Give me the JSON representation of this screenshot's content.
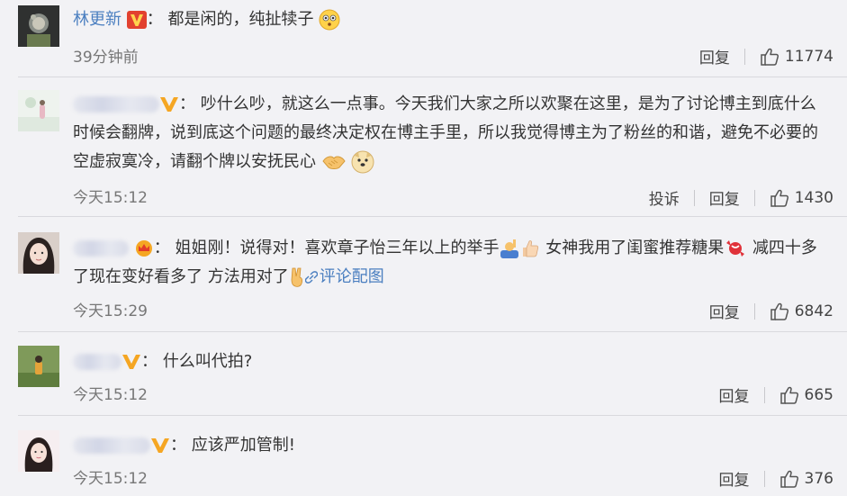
{
  "comments": [
    {
      "username": "林更新",
      "text": "都是闲的，纯扯犊子",
      "time": "39分钟前",
      "reply_label": "回复",
      "likes": "11774"
    },
    {
      "text": "吵什么吵，就这么一点事。今天我们大家之所以欢聚在这里，是为了讨论博主到底什么时候会翻牌，说到底这个问题的最终决定权在博主手里，所以我觉得博主为了粉丝的和谐，避免不必要的空虚寂寞冷，请翻个牌以安抚民心",
      "time": "今天15:12",
      "report_label": "投诉",
      "reply_label": "回复",
      "likes": "1430"
    },
    {
      "text_a": "姐姐刚！说得对！喜欢章子怡三年以上的举手",
      "text_b": "女神我用了闺蜜推荐糖果",
      "text_c": "减四十多了现在变好看多了 方法用对了",
      "link": "评论配图",
      "time": "今天15:29",
      "reply_label": "回复",
      "likes": "6842"
    },
    {
      "text": "什么叫代拍?",
      "time": "今天15:12",
      "reply_label": "回复",
      "likes": "665"
    },
    {
      "text": "应该严加管制!",
      "time": "今天15:12",
      "reply_label": "回复",
      "likes": "376"
    }
  ],
  "colors": {
    "link": "#4b7fc0",
    "background": "#f2f2f5",
    "badge_orange": "#f5a623"
  },
  "icons": [
    "verified-v-icon",
    "crown-icon",
    "thumbs-up-icon",
    "flushed-face-emoji",
    "handshake-emoji",
    "doge-emoji",
    "raising-hand-emoji",
    "thumbs-up-emoji",
    "candy-emoji",
    "victory-hand-emoji"
  ]
}
